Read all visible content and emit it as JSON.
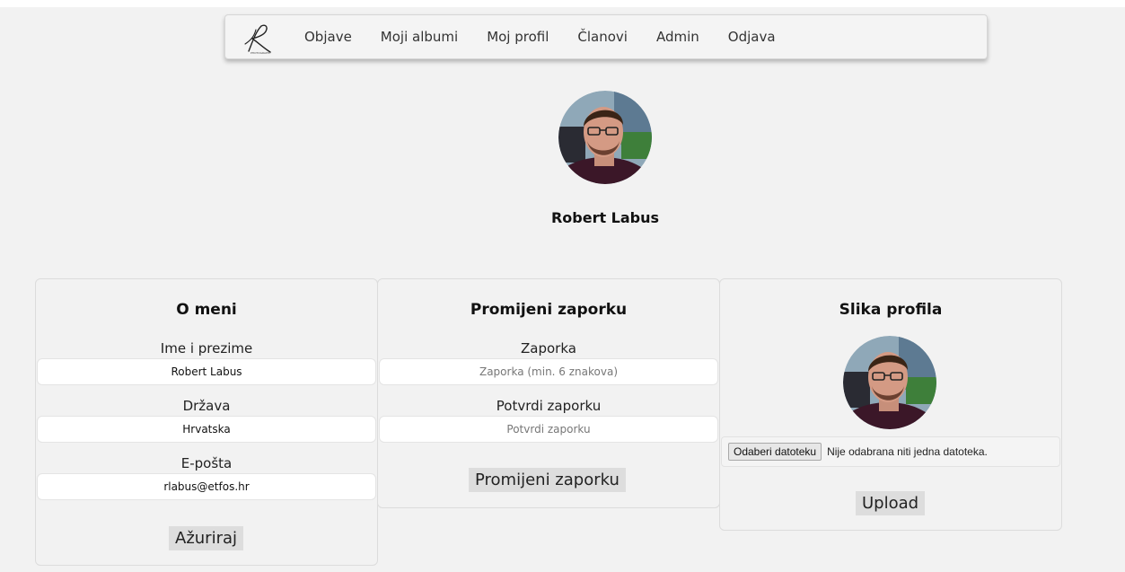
{
  "nav": {
    "items": [
      "Objave",
      "Moji albumi",
      "Moj profil",
      "Članovi",
      "Admin",
      "Odjava"
    ]
  },
  "profile": {
    "name": "Robert Labus"
  },
  "about": {
    "title": "O meni",
    "name_label": "Ime i prezime",
    "name_value": "Robert Labus",
    "country_label": "Država",
    "country_value": "Hrvatska",
    "email_label": "E-pošta",
    "email_value": "rlabus@etfos.hr",
    "submit_label": "Ažuriraj"
  },
  "password": {
    "title": "Promijeni zaporku",
    "pass_label": "Zaporka",
    "pass_placeholder": "Zaporka (min. 6 znakova)",
    "confirm_label": "Potvrdi zaporku",
    "confirm_placeholder": "Potvrdi zaporku",
    "submit_label": "Promijeni zaporku"
  },
  "photo": {
    "title": "Slika profila",
    "file_button": "Odaberi datoteku",
    "file_status": "Nije odabrana niti jedna datoteka.",
    "upload_label": "Upload"
  }
}
